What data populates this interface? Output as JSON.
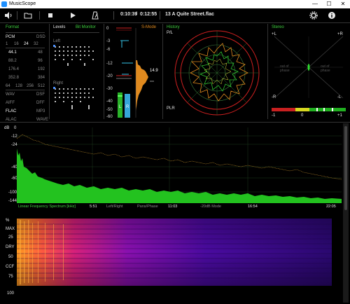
{
  "window": {
    "title": "MusicScope",
    "min": "—",
    "max": "☐",
    "close": "✕"
  },
  "toolbar": {
    "elapsed": "0:10:39",
    "slash": "/",
    "total": "0:12:55",
    "file": "13 A Quite Street.flac"
  },
  "format": {
    "header": "Format",
    "pcm": "PCM",
    "dsd": "DSD",
    "bits": [
      "1",
      "16",
      "24",
      "32"
    ],
    "rates_left": [
      "44.1",
      "88.2",
      "176.4",
      "352.8"
    ],
    "rates_right": [
      "48",
      "96",
      "192",
      "384"
    ],
    "dsd_rates": [
      "64",
      "128",
      "256",
      "512"
    ],
    "codecs_left": [
      "WAV",
      "AIFF",
      "FLAC",
      "ALAC"
    ],
    "codecs_right": [
      "DSF",
      "DFF",
      "MP3",
      "WAVE"
    ]
  },
  "levels": {
    "header": "Levels",
    "bit_monitor": "Bit Monitor",
    "left": "Left",
    "right": "Right"
  },
  "smode": {
    "header": "S-Mode",
    "readout": "14.9",
    "scale": [
      "0",
      "-3",
      "-6",
      "-12",
      "-20",
      "-30",
      "-40",
      "-50",
      "-60"
    ],
    "bar_labels": [
      "L",
      "R"
    ]
  },
  "history": {
    "header": "History",
    "pl_label": "P/L",
    "plr_label": "PLR"
  },
  "stereo": {
    "header": "Stereo",
    "plus_l": "+L",
    "plus_r": "+R",
    "minus_r": "-R",
    "minus_l": "-L",
    "out_phase_left": "out of phase",
    "out_phase_right": "out of phase",
    "corr_min": "-1",
    "corr_mid": "0",
    "corr_max": "+1"
  },
  "spectrum": {
    "db_label": "dB",
    "y_ticks": [
      "0",
      "-12",
      "-24",
      "-40",
      "-60",
      "-100",
      "-144"
    ],
    "x_ticks": [
      "5:51",
      "11:03",
      "16:54",
      "22:05"
    ],
    "mode_linear": "Linear Frequency Spectrum [kHz]",
    "mode_lr": "Left/Right",
    "mode_pan": "Pans/Phase",
    "mode_db": "-20dB Mode"
  },
  "spectrogram": {
    "y_ticks": [
      "%",
      "MAX",
      "25",
      "DRY",
      "50",
      "CCF",
      "75",
      "100"
    ]
  },
  "colors": {
    "accent": "#3fd13f",
    "peak": "#e08a1e",
    "spectrum_fill": "#23c21f"
  },
  "icons": [
    "volume-icon",
    "folder-icon",
    "stop-icon",
    "play-icon",
    "metronome-icon",
    "gear-icon",
    "info-icon"
  ]
}
